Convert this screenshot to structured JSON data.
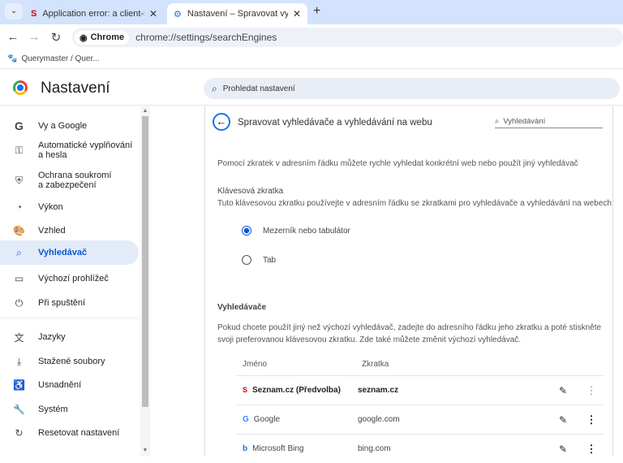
{
  "tabs": [
    {
      "title": "Application error: a client-side exception",
      "icon": "seznam-icon"
    },
    {
      "title": "Nastavení – Spravovat vyhledávače",
      "icon": "gear-icon"
    }
  ],
  "omnibox": {
    "chip": "Chrome",
    "url": "chrome://settings/searchEngines"
  },
  "bookmarks": [
    {
      "label": "Querymaster / Quer..."
    }
  ],
  "header": {
    "title": "Nastavení",
    "search_placeholder": "Prohledat nastavení"
  },
  "sidebar": {
    "items": [
      {
        "label": "Vy a Google",
        "icon": "G"
      },
      {
        "label": "Automatické vyplňování\na hesla",
        "icon": "⚿"
      },
      {
        "label": "Ochrana soukromí\na zabezpečení",
        "icon": "⛨"
      },
      {
        "label": "Výkon",
        "icon": "◔"
      },
      {
        "label": "Vzhled",
        "icon": "🎨"
      },
      {
        "label": "Vyhledávač",
        "icon": "⌕"
      },
      {
        "label": "Výchozí prohlížeč",
        "icon": "▭"
      },
      {
        "label": "Při spuštění",
        "icon": "⏻"
      },
      {
        "label": "Jazyky",
        "icon": "文"
      },
      {
        "label": "Stažené soubory",
        "icon": "⤓"
      },
      {
        "label": "Usnadnění",
        "icon": "♿"
      },
      {
        "label": "Systém",
        "icon": "🔧"
      },
      {
        "label": "Resetovat nastavení",
        "icon": "↻"
      }
    ]
  },
  "page": {
    "title": "Spravovat vyhledávače a vyhledávání na webu",
    "search_placeholder": "Vyhledávání",
    "intro": "Pomocí zkratek v adresním řádku můžete rychle vyhledat konkrétní web nebo použít jiný vyhledávač",
    "shortcut_heading": "Klávesová zkratka",
    "shortcut_desc": "Tuto klávesovou zkratku používejte v adresním řádku se zkratkami pro vyhledávače a vyhledávání na webech",
    "options": [
      {
        "label": "Mezerník nebo tabulátor",
        "selected": true
      },
      {
        "label": "Tab",
        "selected": false
      }
    ],
    "engines_heading": "Vyhledávače",
    "engines_desc": "Pokud chcete použít jiný než výchozí vyhledávač, zadejte do adresního řádku jeho zkratku a poté stiskněte svoji preferovanou klávesovou zkratku. Zde také můžete změnit výchozí vyhledávač.",
    "col_name": "Jméno",
    "col_shortcut": "Zkratka",
    "engines": [
      {
        "name": "Seznam.cz (Předvolba)",
        "shortcut": "seznam.cz",
        "default": true
      },
      {
        "name": "Google",
        "shortcut": "google.com",
        "default": false
      },
      {
        "name": "Microsoft Bing",
        "shortcut": "bing.com",
        "default": false
      }
    ]
  }
}
